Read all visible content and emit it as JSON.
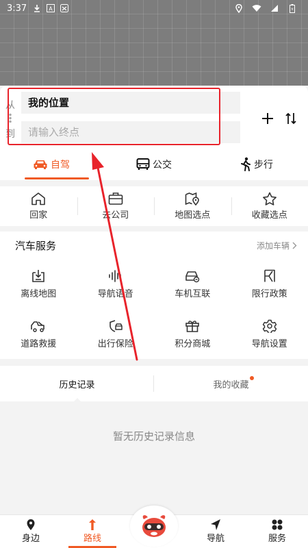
{
  "status_bar": {
    "time": "3:37"
  },
  "route": {
    "from_side_label": "从",
    "to_side_label": "到",
    "from_value": "我的位置",
    "to_placeholder": "请输入终点"
  },
  "mode_tabs": [
    {
      "label": "自驾",
      "icon": "car-icon"
    },
    {
      "label": "公交",
      "icon": "bus-icon"
    },
    {
      "label": "步行",
      "icon": "walk-icon"
    }
  ],
  "quick_links": [
    {
      "label": "回家",
      "icon": "home-icon"
    },
    {
      "label": "去公司",
      "icon": "briefcase-icon"
    },
    {
      "label": "地图选点",
      "icon": "map-pin-icon"
    },
    {
      "label": "收藏选点",
      "icon": "star-icon"
    }
  ],
  "services": {
    "title": "汽车服务",
    "add_vehicle": "添加车辆",
    "items": [
      {
        "label": "离线地图",
        "icon": "download-map-icon"
      },
      {
        "label": "导航语音",
        "icon": "voice-icon"
      },
      {
        "label": "车机互联",
        "icon": "car-link-icon"
      },
      {
        "label": "限行政策",
        "icon": "restriction-icon"
      },
      {
        "label": "道路救援",
        "icon": "tow-truck-icon"
      },
      {
        "label": "出行保险",
        "icon": "shield-car-icon"
      },
      {
        "label": "积分商城",
        "icon": "gift-icon"
      },
      {
        "label": "导航设置",
        "icon": "settings-icon"
      }
    ]
  },
  "history": {
    "tab_history": "历史记录",
    "tab_favorites": "我的收藏",
    "empty_text": "暂无历史记录信息"
  },
  "bottom_nav": {
    "nearby": "身边",
    "route": "路线",
    "navigate": "导航",
    "services": "服务"
  },
  "colors": {
    "accent": "#f05a24",
    "highlight_box": "#e8232b"
  }
}
